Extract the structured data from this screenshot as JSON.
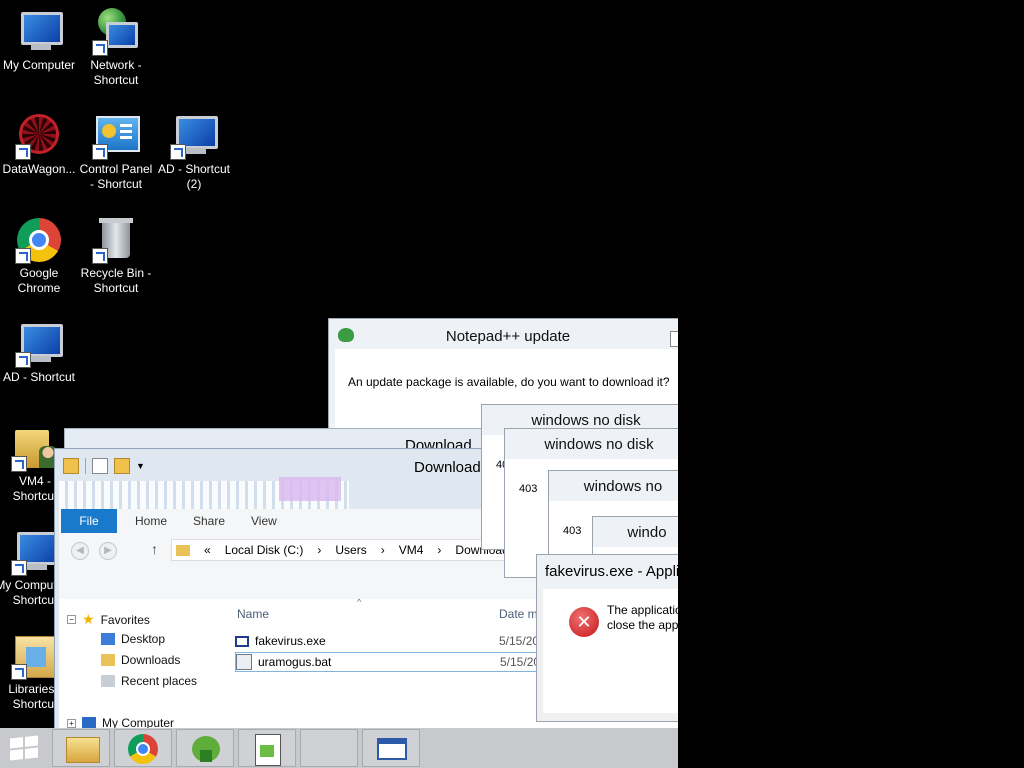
{
  "desktop": {
    "icons": [
      {
        "label": "My Computer",
        "icon": "monitor-icon"
      },
      {
        "label": "Network - Shortcut",
        "icon": "network-icon"
      },
      {
        "label": "DataWagon...",
        "icon": "datawagon-icon"
      },
      {
        "label": "Control Panel - Shortcut",
        "icon": "control-panel-icon"
      },
      {
        "label": "AD - Shortcut (2)",
        "icon": "monitor-icon"
      },
      {
        "label": "Google Chrome",
        "icon": "chrome-icon"
      },
      {
        "label": "Recycle Bin - Shortcut",
        "icon": "recycle-bin-icon"
      },
      {
        "label": "AD - Shortcut",
        "icon": "monitor-icon"
      },
      {
        "label": "VM4 - Shortcut",
        "icon": "user-folder-icon"
      },
      {
        "label": "My Computer - Shortcut",
        "icon": "monitor-icon"
      },
      {
        "label": "Libraries - Shortcut",
        "icon": "libraries-icon"
      }
    ]
  },
  "npp_dialog": {
    "title": "Notepad++ update",
    "message": "An update package is available, do you want to download it?"
  },
  "background_window": {
    "title": "Download"
  },
  "explorer": {
    "title": "Download",
    "tabs": [
      "File",
      "Home",
      "Share",
      "View"
    ],
    "address": [
      "«",
      "Local Disk (C:)",
      "›",
      "Users",
      "›",
      "VM4",
      "›",
      "Downloads"
    ],
    "nav": {
      "favorites": "Favorites",
      "desktop": "Desktop",
      "downloads": "Downloads",
      "recent": "Recent places",
      "computer": "My Computer"
    },
    "columns": {
      "name": "Name",
      "date": "Date m"
    },
    "files": [
      {
        "name": "fakevirus.exe",
        "date": "5/15/20"
      },
      {
        "name": "uramogus.bat",
        "date": "5/15/20"
      }
    ]
  },
  "nodisk_dialogs": [
    {
      "title": "windows no disk",
      "code": "40"
    },
    {
      "title": "windows no disk",
      "code": "403"
    },
    {
      "title": "windows no",
      "code": "403"
    },
    {
      "title": "windo",
      "code": ""
    }
  ],
  "error_dialog": {
    "title": "fakevirus.exe - Appli",
    "line1": "The applicatio",
    "line2": "close the app"
  },
  "taskbar": {
    "items": [
      "start-button",
      "file-explorer",
      "google-chrome",
      "notepadpp-updater",
      "notepadpp",
      "blank-window",
      "generic-window"
    ]
  }
}
